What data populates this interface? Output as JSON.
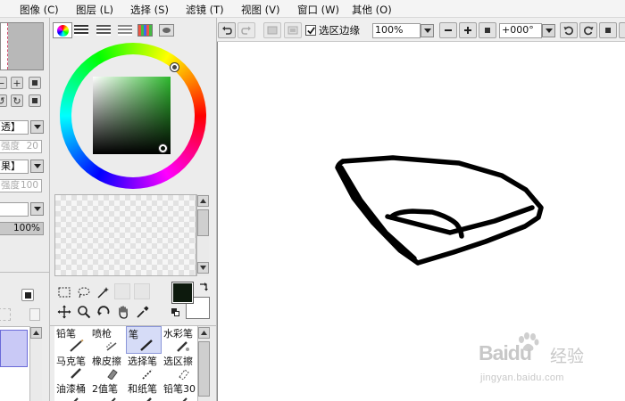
{
  "menu": {
    "items": [
      "图像 (C)",
      "图层 (L)",
      "选择 (S)",
      "滤镜 (T)",
      "视图 (V)",
      "窗口 (W)",
      "其他 (O)"
    ]
  },
  "left_panel": {
    "dropdown1_value": "透】",
    "slider1": {
      "label": "强度",
      "value": "20"
    },
    "dropdown2_value": "果】",
    "slider2": {
      "label": "强度",
      "value": "100"
    },
    "dropdown3_value": "",
    "percent": "100%"
  },
  "toolbar": {
    "selection_edge_label": "选区边缘",
    "selection_edge_checked": true,
    "zoom_value": "100%",
    "rotation_value": "+000°"
  },
  "brushes": [
    {
      "label": "铅笔"
    },
    {
      "label": "喷枪"
    },
    {
      "label": "笔",
      "selected": true
    },
    {
      "label": "水彩笔"
    },
    {
      "label": "马克笔"
    },
    {
      "label": "橡皮擦"
    },
    {
      "label": "选择笔"
    },
    {
      "label": "选区擦"
    },
    {
      "label": "油漆桶"
    },
    {
      "label": "2值笔"
    },
    {
      "label": "和纸笔"
    },
    {
      "label": "铅笔30"
    }
  ],
  "colors": {
    "primary": "#0d1a0d",
    "secondary": "#ffffff",
    "layer_highlight": "#c9c9f6",
    "selected_brush_bg": "#d6dcf7",
    "canvas_stroke": "#000000"
  },
  "watermark": {
    "logo": "Baidu",
    "product": "经验",
    "url": "jingyan.baidu.com"
  }
}
